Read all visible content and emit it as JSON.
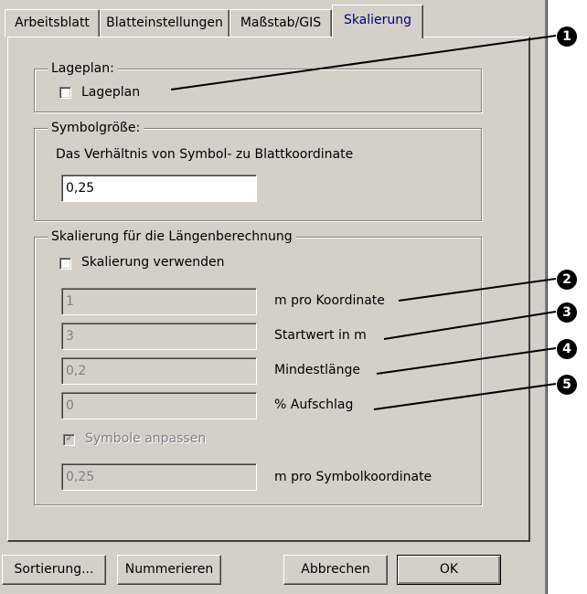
{
  "tabs": [
    {
      "label": "Arbeitsblatt"
    },
    {
      "label": "Blatteinstellungen"
    },
    {
      "label": "Maßstab/GIS"
    },
    {
      "label": "Skalierung"
    }
  ],
  "lageplan_group": {
    "legend": "Lageplan:",
    "checkbox_label": "Lageplan"
  },
  "symbol_group": {
    "legend": "Symbolgröße:",
    "description": "Das Verhältnis von Symbol- zu Blattkoordinate",
    "value": "0,25"
  },
  "scale_group": {
    "legend": "Skalierung für die Längenberechnung",
    "checkbox_label": "Skalierung verwenden",
    "rows": [
      {
        "value": "1",
        "label": "m pro Koordinate"
      },
      {
        "value": "3",
        "label": "Startwert in m"
      },
      {
        "value": "0,2",
        "label": "Mindestlänge"
      },
      {
        "value": "0",
        "label": "% Aufschlag"
      }
    ],
    "symbol_checkbox_label": "Symbole anpassen",
    "symbol_value": "0,25",
    "symbol_label": "m pro Symbolkoordinate"
  },
  "buttons": {
    "sort": "Sortierung...",
    "number": "Nummerieren",
    "cancel": "Abbrechen",
    "ok": "OK"
  },
  "callouts": [
    "1",
    "2",
    "3",
    "4",
    "5"
  ]
}
